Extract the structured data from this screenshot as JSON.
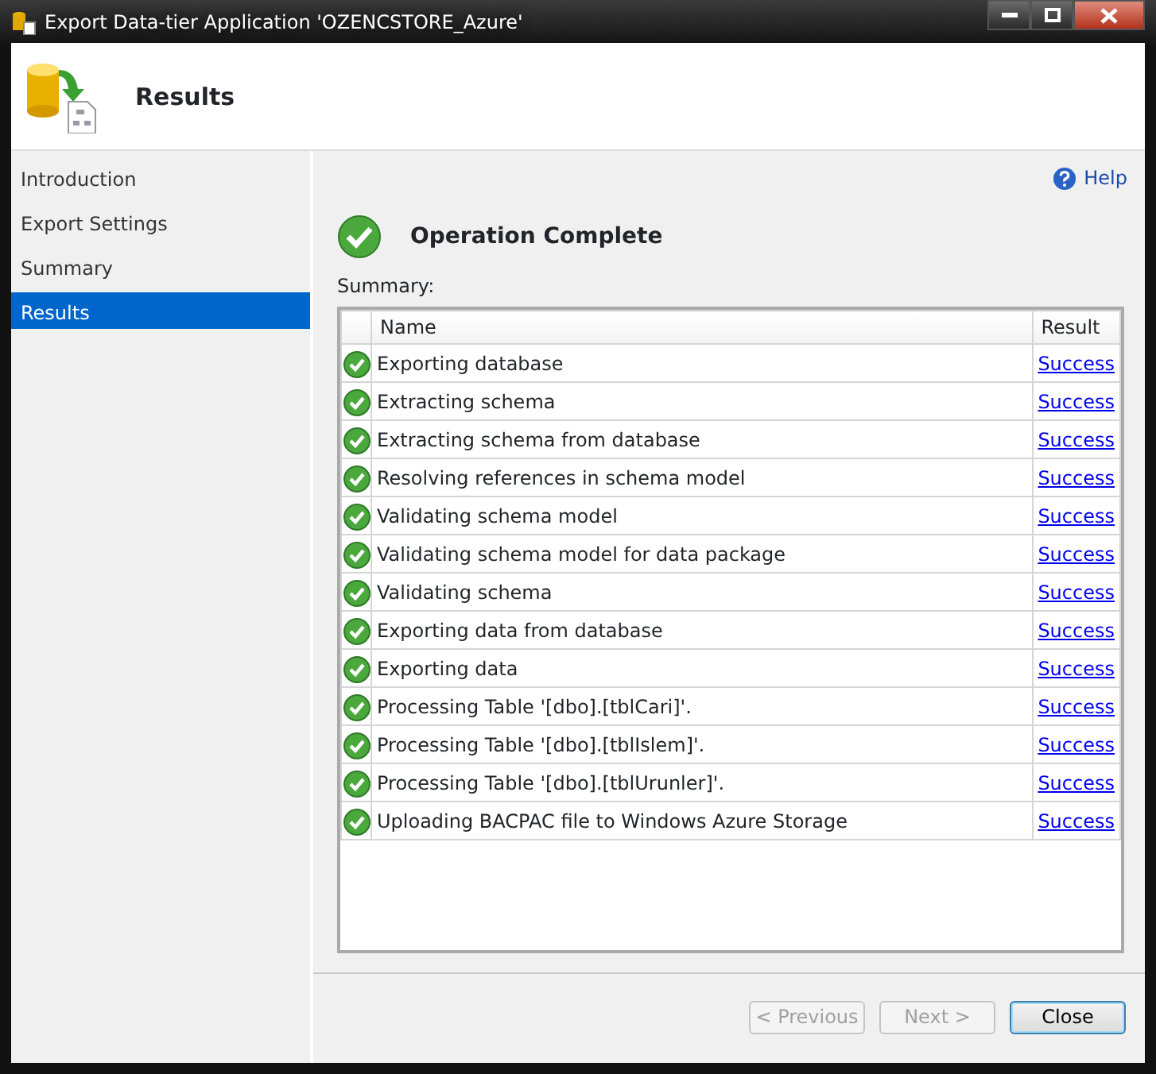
{
  "window": {
    "title": "Export Data-tier Application 'OZENCSTORE_Azure'"
  },
  "header": {
    "title": "Results"
  },
  "sidebar": {
    "items": [
      {
        "label": "Introduction",
        "selected": false
      },
      {
        "label": "Export Settings",
        "selected": false
      },
      {
        "label": "Summary",
        "selected": false
      },
      {
        "label": "Results",
        "selected": true
      }
    ]
  },
  "help": {
    "label": "Help"
  },
  "status": {
    "title": "Operation Complete"
  },
  "summary_label": "Summary:",
  "table": {
    "columns": [
      "Name",
      "Result"
    ],
    "rows": [
      {
        "name": "Exporting database",
        "result": "Success"
      },
      {
        "name": "Extracting schema",
        "result": "Success"
      },
      {
        "name": "Extracting schema from database",
        "result": "Success"
      },
      {
        "name": "Resolving references in schema model",
        "result": "Success"
      },
      {
        "name": "Validating schema model",
        "result": "Success"
      },
      {
        "name": "Validating schema model for data package",
        "result": "Success"
      },
      {
        "name": "Validating schema",
        "result": "Success"
      },
      {
        "name": "Exporting data from database",
        "result": "Success"
      },
      {
        "name": "Exporting data",
        "result": "Success"
      },
      {
        "name": "Processing Table '[dbo].[tblCari]'.",
        "result": "Success"
      },
      {
        "name": "Processing Table '[dbo].[tblIslem]'.",
        "result": "Success"
      },
      {
        "name": "Processing Table '[dbo].[tblUrunler]'.",
        "result": "Success"
      },
      {
        "name": "Uploading BACPAC file to Windows Azure Storage",
        "result": "Success"
      }
    ]
  },
  "buttons": [
    {
      "label": "< Previous",
      "disabled": true
    },
    {
      "label": "Next >",
      "disabled": true
    },
    {
      "label": "Close",
      "disabled": false
    }
  ]
}
